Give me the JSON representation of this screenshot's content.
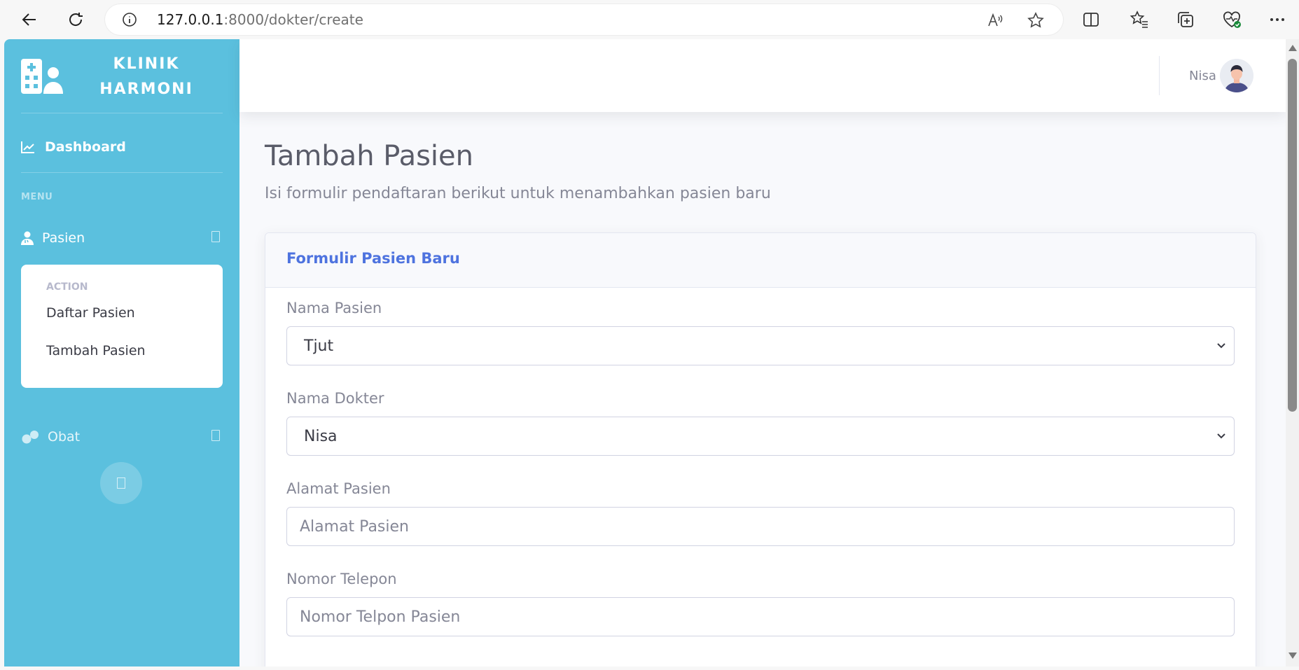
{
  "browser": {
    "url_host": "127.0.0.1",
    "url_rest": ":8000/dokter/create"
  },
  "sidebar": {
    "brand_line1": "KLINIK",
    "brand_line2": "HARMONI",
    "dashboard_label": "Dashboard",
    "menu_heading": "MENU",
    "pasien_label": "Pasien",
    "submenu": {
      "heading": "ACTION",
      "items": [
        {
          "label": "Daftar Pasien"
        },
        {
          "label": "Tambah Pasien"
        }
      ]
    },
    "obat_label": "Obat"
  },
  "topbar": {
    "user_name": "Nisa"
  },
  "page": {
    "title": "Tambah Pasien",
    "subtitle": "Isi formulir pendaftaran berikut untuk menambahkan pasien baru"
  },
  "form": {
    "card_title": "Formulir Pasien Baru",
    "fields": [
      {
        "label": "Nama Pasien",
        "value": "Tjut"
      },
      {
        "label": "Nama Dokter",
        "value": "Nisa"
      },
      {
        "label": "Alamat Pasien",
        "placeholder": "Alamat Pasien"
      },
      {
        "label": "Nomor Telepon",
        "placeholder": "Nomor Telpon Pasien"
      }
    ]
  },
  "colors": {
    "sidebar": "#5bc0de",
    "primary": "#4e73df",
    "text_muted": "#858796"
  }
}
